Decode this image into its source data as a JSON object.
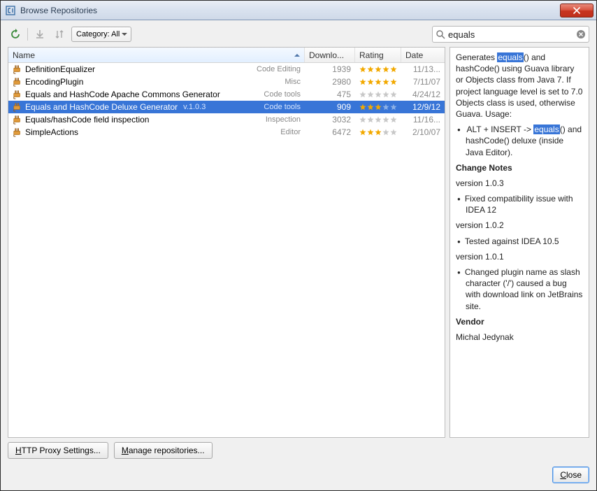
{
  "window": {
    "title": "Browse Repositories"
  },
  "toolbar": {
    "category_label": "Category: All"
  },
  "search": {
    "placeholder": "",
    "value": "equals"
  },
  "columns": {
    "name": "Name",
    "downloads": "Downlo...",
    "rating": "Rating",
    "date": "Date"
  },
  "rows": [
    {
      "name": "DefinitionEqualizer",
      "version": "",
      "category": "Code Editing",
      "downloads": "1939",
      "rating": 5,
      "date": "11/13...",
      "selected": false
    },
    {
      "name": "EncodingPlugin",
      "version": "",
      "category": "Misc",
      "downloads": "2980",
      "rating": 5,
      "date": "7/11/07",
      "selected": false
    },
    {
      "name": "Equals and HashCode Apache Commons Generator",
      "version": "",
      "category": "Code tools",
      "downloads": "475",
      "rating": 0,
      "date": "4/24/12",
      "selected": false
    },
    {
      "name": "Equals and HashCode Deluxe Generator",
      "version": "v.1.0.3",
      "category": "Code tools",
      "downloads": "909",
      "rating": 3,
      "date": "12/9/12",
      "selected": true
    },
    {
      "name": "Equals/hashCode field inspection",
      "version": "",
      "category": "Inspection",
      "downloads": "3032",
      "rating": 0,
      "date": "11/16...",
      "selected": false
    },
    {
      "name": "SimpleActions",
      "version": "",
      "category": "Editor",
      "downloads": "6472",
      "rating": 3,
      "date": "2/10/07",
      "selected": false
    }
  ],
  "detail": {
    "desc_pre": "Generates ",
    "desc_hl1": "equals",
    "desc_post1": "() and hashCode() using Guava library or Objects class from Java 7. If project language level is set to 7.0 Objects class is used, otherwise Guava. Usage:",
    "usage_pre": "ALT + INSERT -> ",
    "usage_hl": "equals",
    "usage_post": "() and hashCode() deluxe (inside Java Editor).",
    "change_heading": "Change Notes",
    "v103_label": "version 1.0.3",
    "v103_item": "Fixed compatibility issue with IDEA 12",
    "v102_label": "version 1.0.2",
    "v102_item": "Tested against IDEA 10.5",
    "v101_label": "version 1.0.1",
    "v101_item": "Changed plugin name as slash character ('/') caused a bug with download link on JetBrains site.",
    "vendor_heading": "Vendor",
    "vendor_name": "Michal Jedynak"
  },
  "buttons": {
    "proxy": "HTTP Proxy Settings...",
    "manage": "Manage repositories...",
    "close": "Close"
  }
}
